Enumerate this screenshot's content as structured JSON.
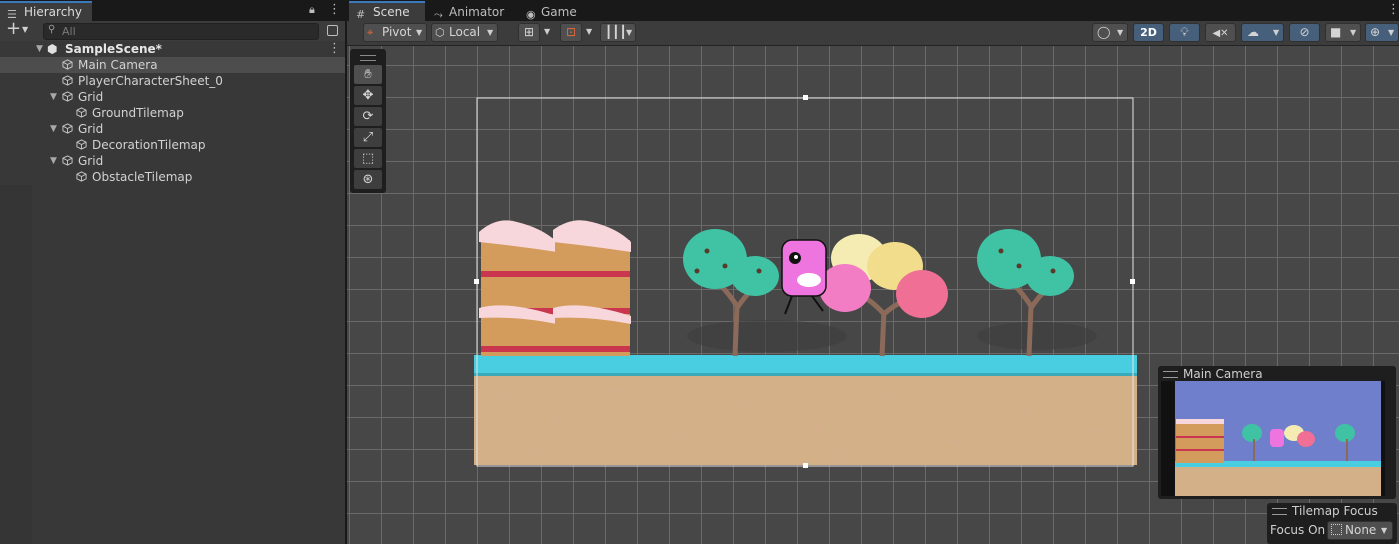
{
  "hierarchy": {
    "tab_label": "Hierarchy",
    "add_label": "+",
    "search_placeholder": "All",
    "scene_name": "SampleScene*",
    "items": [
      {
        "label": "Main Camera"
      },
      {
        "label": "PlayerCharacterSheet_0"
      },
      {
        "label": "Grid"
      },
      {
        "label": "GroundTilemap"
      },
      {
        "label": "Grid"
      },
      {
        "label": "DecorationTilemap"
      },
      {
        "label": "Grid"
      },
      {
        "label": "ObstacleTilemap"
      }
    ]
  },
  "tabs": [
    {
      "label": "Scene"
    },
    {
      "label": "Animator"
    },
    {
      "label": "Game"
    }
  ],
  "toolbar": {
    "pivot_label": "Pivot",
    "local_label": "Local",
    "mode_2d_label": "2D"
  },
  "camera_preview": {
    "title": "Main Camera"
  },
  "tilemap_focus": {
    "title": "Tilemap Focus",
    "focus_on_label": "Focus On",
    "focus_value": "None"
  },
  "colors": {
    "accent_tab": "#3a79bb",
    "sky": "#6f7fcb",
    "ground_top": "#48cde1",
    "ground": "#d3b088"
  }
}
